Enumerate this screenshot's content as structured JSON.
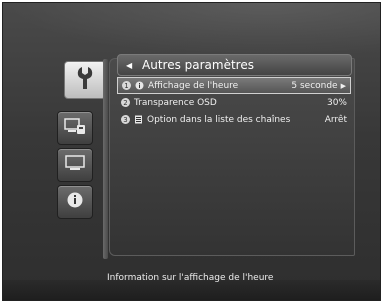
{
  "header": {
    "title": "Autres paramètres"
  },
  "sidebar": {
    "icons": [
      {
        "name": "wrench-icon",
        "active": true
      },
      {
        "name": "network-settings-icon",
        "active": false
      },
      {
        "name": "screen-icon",
        "active": false
      },
      {
        "name": "info-icon",
        "active": false
      }
    ]
  },
  "menu": {
    "items": [
      {
        "number": "1",
        "icon": "info-icon",
        "label": "Affichage de l'heure",
        "value": "5 seconde",
        "selected": true
      },
      {
        "number": "2",
        "icon": "",
        "label": "Transparence OSD",
        "value": "30%",
        "selected": false
      },
      {
        "number": "3",
        "icon": "list-icon",
        "label": "Option dans la liste des chaînes",
        "value": "Arrêt",
        "selected": false
      }
    ]
  },
  "footer": {
    "info": "Information sur l'affichage de l'heure"
  }
}
